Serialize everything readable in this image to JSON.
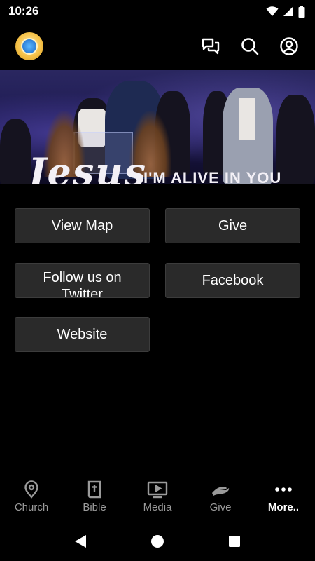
{
  "status_bar": {
    "time": "10:26"
  },
  "header": {
    "logo": "church-logo"
  },
  "banner": {
    "script_text": "Jesus",
    "caption": "I'M ALIVE IN YOU"
  },
  "links": [
    {
      "label": "View Map"
    },
    {
      "label": "Give"
    },
    {
      "label": "Follow us on Twitter"
    },
    {
      "label": "Facebook"
    },
    {
      "label": "Website"
    }
  ],
  "bottom_nav": {
    "items": [
      {
        "label": "Church",
        "icon": "location-pin-icon"
      },
      {
        "label": "Bible",
        "icon": "bible-icon"
      },
      {
        "label": "Media",
        "icon": "play-screen-icon"
      },
      {
        "label": "Give",
        "icon": "give-hand-icon"
      },
      {
        "label": "More..",
        "icon": "more-dots-icon",
        "active": true
      }
    ]
  },
  "colors": {
    "background": "#000000",
    "button": "#2a2a2a",
    "inactive_nav": "#9a9a9a",
    "active_nav": "#ffffff"
  }
}
